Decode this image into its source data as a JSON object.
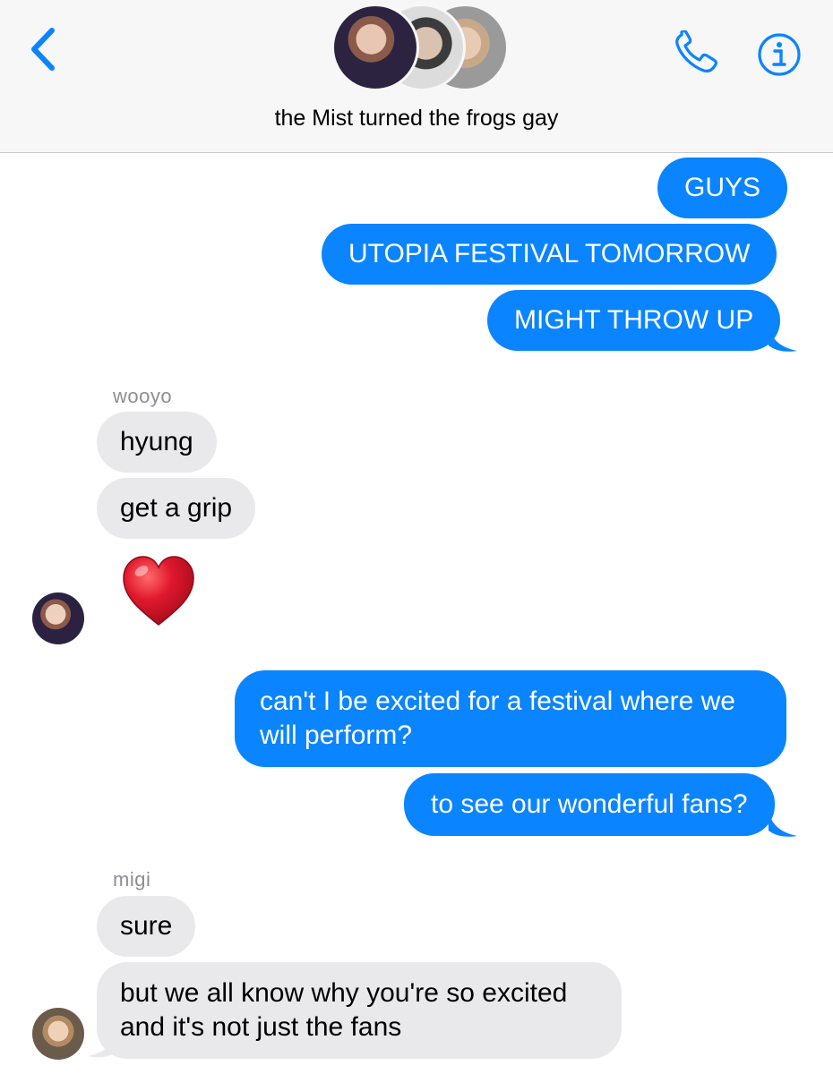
{
  "header": {
    "title": "the Mist turned the frogs gay",
    "back_icon": "chevron-left-icon",
    "call_icon": "phone-icon",
    "info_icon": "info-icon",
    "accent_color": "#0a84ff"
  },
  "messages": [
    {
      "direction": "out",
      "text": "GUYS"
    },
    {
      "direction": "out",
      "text": "UTOPIA FESTIVAL TOMORROW"
    },
    {
      "direction": "out",
      "text": "MIGHT THROW UP"
    },
    {
      "sender": "wooyo",
      "direction": "in",
      "text": "hyung"
    },
    {
      "sender": "wooyo",
      "direction": "in",
      "text": "get a grip"
    },
    {
      "sender": "wooyo",
      "direction": "in",
      "emoji": "red-heart"
    },
    {
      "direction": "out",
      "text_lines": [
        "can't I be excited for a festival where we",
        "will perform?"
      ]
    },
    {
      "direction": "out",
      "text": "to see our wonderful fans?"
    },
    {
      "sender": "migi",
      "direction": "in",
      "text": "sure"
    },
    {
      "sender": "migi",
      "direction": "in",
      "text_lines": [
        "but we all know why you're so excited",
        "and it's not just the fans"
      ]
    }
  ],
  "senders": {
    "wooyo": "wooyo",
    "migi": "migi"
  },
  "colors": {
    "outgoing_bubble": "#0a84ff",
    "incoming_bubble": "#e9e9eb",
    "heart": "#e0182d"
  }
}
